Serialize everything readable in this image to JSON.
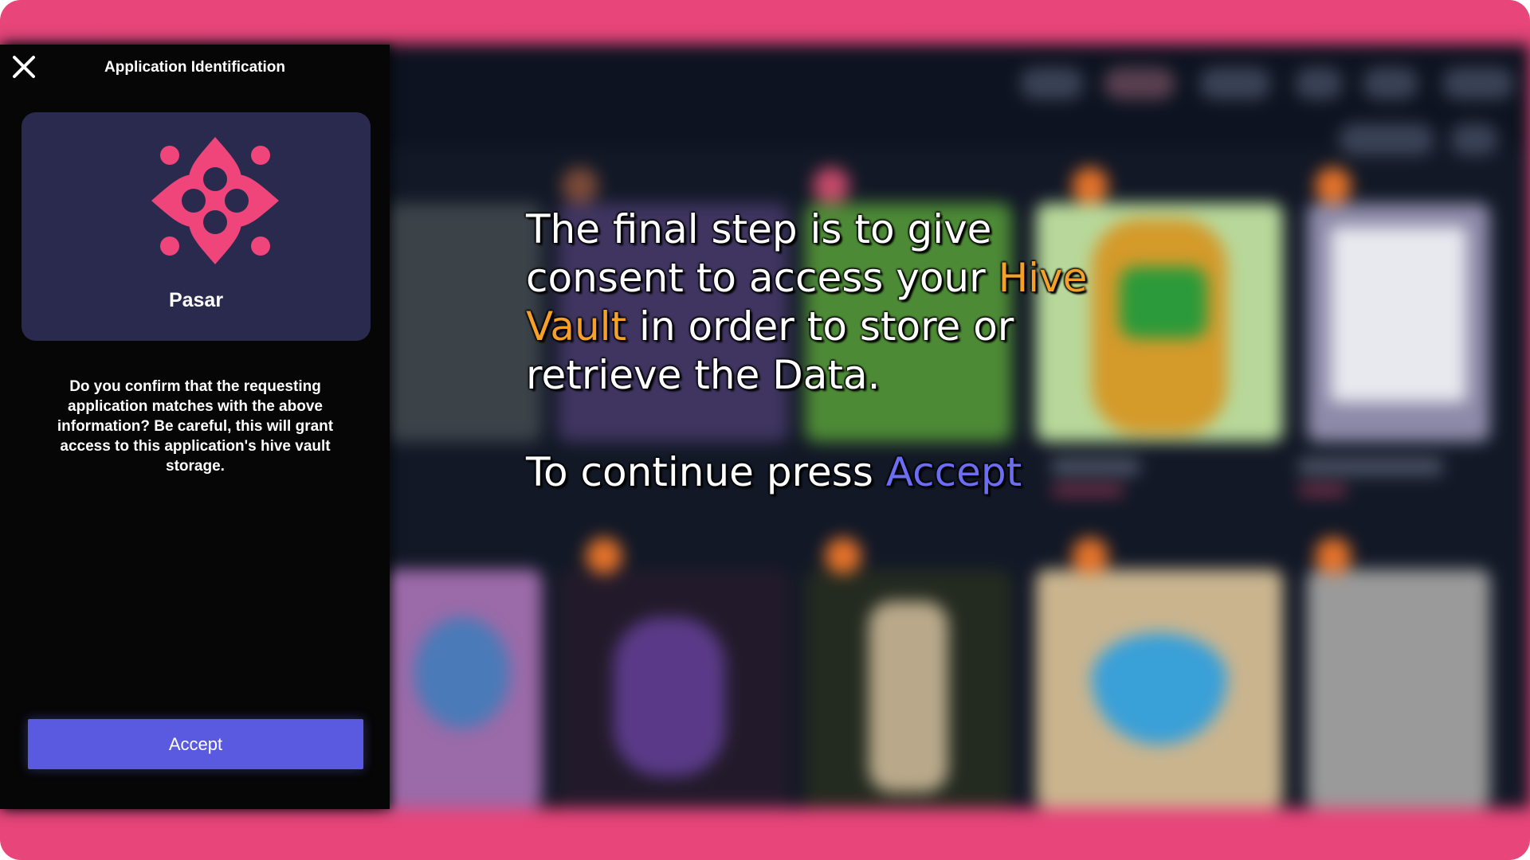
{
  "panel": {
    "title": "Application Identification",
    "close_icon": "close-icon",
    "app": {
      "name": "Pasar",
      "logo_icon": "pasar-logo-icon",
      "logo_color": "#f0457a"
    },
    "confirm_text": "Do you confirm that the requesting application matches with the above information? Be careful, this will grant access to this application's hive vault storage.",
    "accept_label": "Accept"
  },
  "overlay": {
    "part1": "The final step is to give consent to access your ",
    "highlight_vault": "Hive Vault",
    "part2": " in order to store or retrieve the Data.",
    "continue_prefix": "To continue press ",
    "continue_highlight": "Accept"
  },
  "colors": {
    "frame": "#e8457a",
    "panel_bg": "#060606",
    "card_bg": "#2a2a4f",
    "accent": "#5a5ae0",
    "overlay_orange": "#f5a029",
    "overlay_blue": "#6b6df5"
  }
}
